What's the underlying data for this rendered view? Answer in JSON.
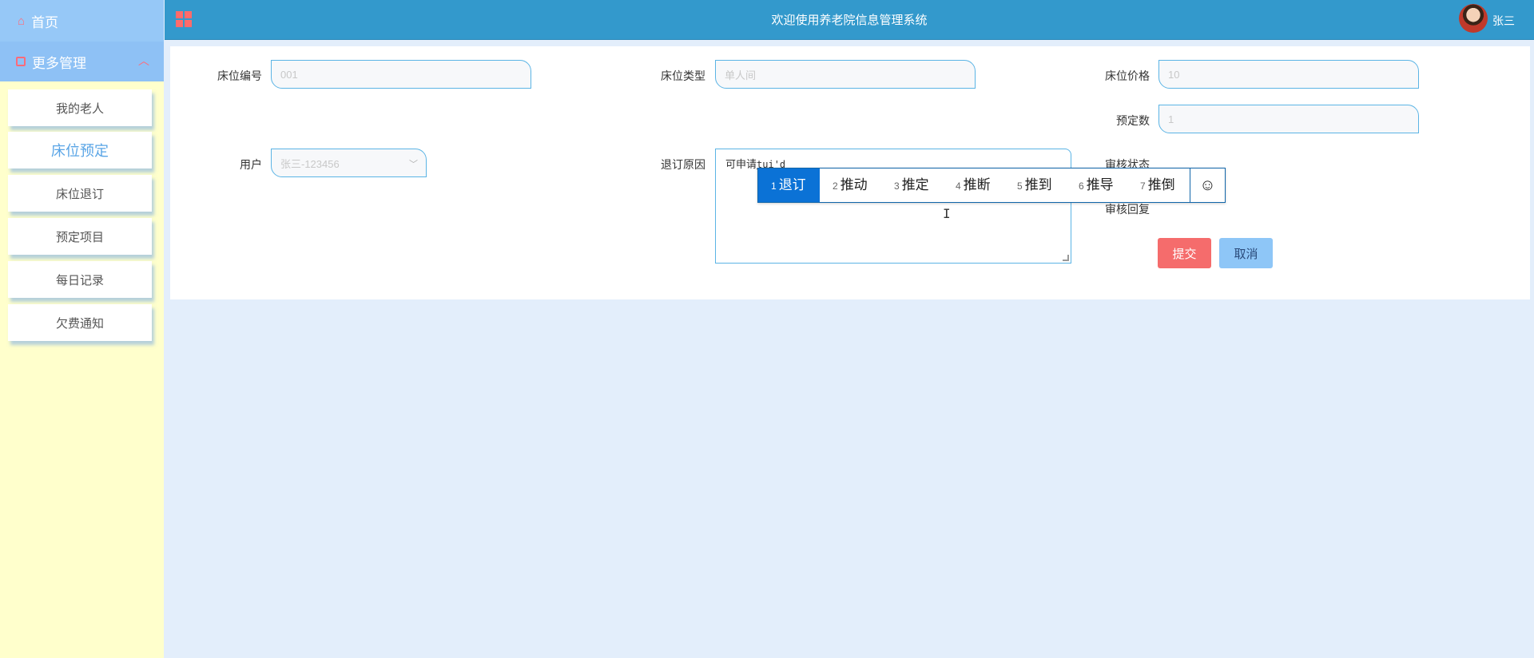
{
  "sidebar": {
    "home": "首页",
    "more": "更多管理",
    "items": [
      {
        "label": "我的老人"
      },
      {
        "label": "床位预定"
      },
      {
        "label": "床位退订"
      },
      {
        "label": "预定项目"
      },
      {
        "label": "每日记录"
      },
      {
        "label": "欠费通知"
      }
    ],
    "active_index": 1
  },
  "header": {
    "title": "欢迎使用养老院信息管理系统",
    "user": "张三"
  },
  "form": {
    "bed_no_label": "床位编号",
    "bed_no_value": "001",
    "bed_type_label": "床位类型",
    "bed_type_value": "单人间",
    "bed_price_label": "床位价格",
    "bed_price_value": "10",
    "booking_count_label": "预定数",
    "booking_count_value": "1",
    "user_label": "用户",
    "user_value": "张三-123456",
    "cancel_reason_label": "退订原因",
    "cancel_reason_text": "可申请",
    "cancel_reason_pinyin": "tui'd",
    "review_status_label": "审核状态",
    "review_reply_label": "审核回复",
    "submit_label": "提交",
    "cancel_label": "取消"
  },
  "ime": {
    "candidates": [
      {
        "num": "1",
        "text": "退订"
      },
      {
        "num": "2",
        "text": "推动"
      },
      {
        "num": "3",
        "text": "推定"
      },
      {
        "num": "4",
        "text": "推断"
      },
      {
        "num": "5",
        "text": "推到"
      },
      {
        "num": "6",
        "text": "推导"
      },
      {
        "num": "7",
        "text": "推倒"
      }
    ],
    "selected_index": 0,
    "emoji_glyph": "☺"
  },
  "colors": {
    "header_bg": "#3399cc",
    "sidebar_bg": "#ffffcc",
    "sidebar_top": "#96c8f7",
    "accent_red": "#f56c6c",
    "accent_blue": "#8ec6f7",
    "ime_select": "#0b72d6"
  }
}
